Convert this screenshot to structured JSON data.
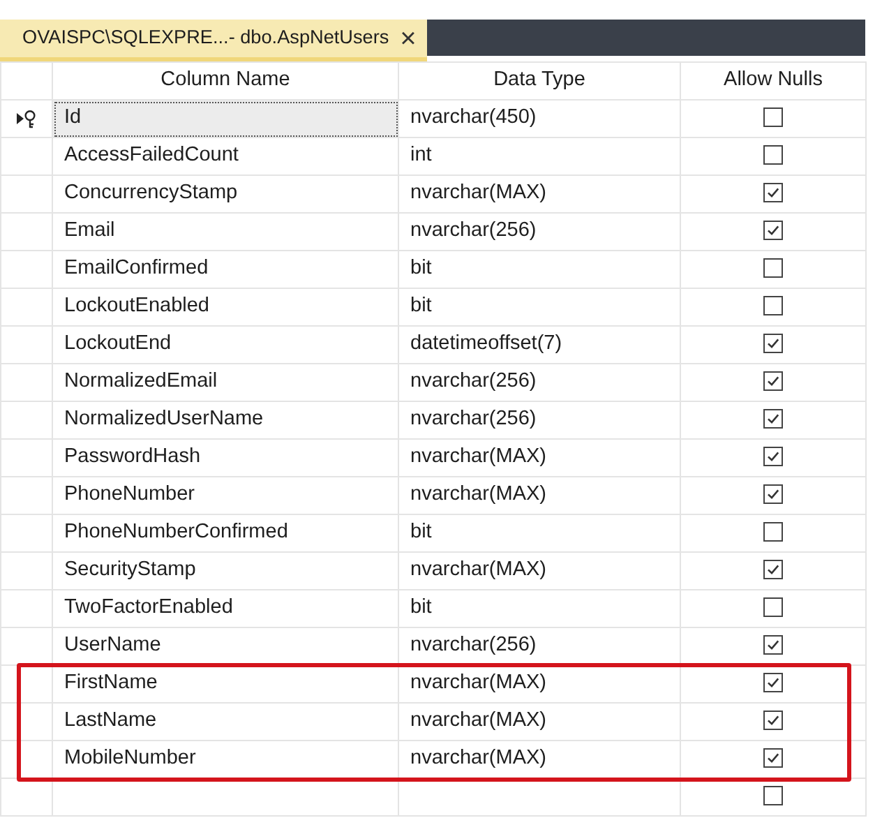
{
  "tab": {
    "title": "OVAISPC\\SQLEXPRE...- dbo.AspNetUsers",
    "close": "×"
  },
  "table": {
    "columns": [
      "Column Name",
      "Data Type",
      "Allow Nulls"
    ],
    "rows": [
      {
        "name": "Id",
        "type": "nvarchar(450)",
        "allow_nulls": false,
        "primary_key": true,
        "selected": true,
        "highlighted": false
      },
      {
        "name": "AccessFailedCount",
        "type": "int",
        "allow_nulls": false,
        "primary_key": false,
        "selected": false,
        "highlighted": false
      },
      {
        "name": "ConcurrencyStamp",
        "type": "nvarchar(MAX)",
        "allow_nulls": true,
        "primary_key": false,
        "selected": false,
        "highlighted": false
      },
      {
        "name": "Email",
        "type": "nvarchar(256)",
        "allow_nulls": true,
        "primary_key": false,
        "selected": false,
        "highlighted": false
      },
      {
        "name": "EmailConfirmed",
        "type": "bit",
        "allow_nulls": false,
        "primary_key": false,
        "selected": false,
        "highlighted": false
      },
      {
        "name": "LockoutEnabled",
        "type": "bit",
        "allow_nulls": false,
        "primary_key": false,
        "selected": false,
        "highlighted": false
      },
      {
        "name": "LockoutEnd",
        "type": "datetimeoffset(7)",
        "allow_nulls": true,
        "primary_key": false,
        "selected": false,
        "highlighted": false
      },
      {
        "name": "NormalizedEmail",
        "type": "nvarchar(256)",
        "allow_nulls": true,
        "primary_key": false,
        "selected": false,
        "highlighted": false
      },
      {
        "name": "NormalizedUserName",
        "type": "nvarchar(256)",
        "allow_nulls": true,
        "primary_key": false,
        "selected": false,
        "highlighted": false
      },
      {
        "name": "PasswordHash",
        "type": "nvarchar(MAX)",
        "allow_nulls": true,
        "primary_key": false,
        "selected": false,
        "highlighted": false
      },
      {
        "name": "PhoneNumber",
        "type": "nvarchar(MAX)",
        "allow_nulls": true,
        "primary_key": false,
        "selected": false,
        "highlighted": false
      },
      {
        "name": "PhoneNumberConfirmed",
        "type": "bit",
        "allow_nulls": false,
        "primary_key": false,
        "selected": false,
        "highlighted": false
      },
      {
        "name": "SecurityStamp",
        "type": "nvarchar(MAX)",
        "allow_nulls": true,
        "primary_key": false,
        "selected": false,
        "highlighted": false
      },
      {
        "name": "TwoFactorEnabled",
        "type": "bit",
        "allow_nulls": false,
        "primary_key": false,
        "selected": false,
        "highlighted": false
      },
      {
        "name": "UserName",
        "type": "nvarchar(256)",
        "allow_nulls": true,
        "primary_key": false,
        "selected": false,
        "highlighted": false
      },
      {
        "name": "FirstName",
        "type": "nvarchar(MAX)",
        "allow_nulls": true,
        "primary_key": false,
        "selected": false,
        "highlighted": true
      },
      {
        "name": "LastName",
        "type": "nvarchar(MAX)",
        "allow_nulls": true,
        "primary_key": false,
        "selected": false,
        "highlighted": true
      },
      {
        "name": "MobileNumber",
        "type": "nvarchar(MAX)",
        "allow_nulls": true,
        "primary_key": false,
        "selected": false,
        "highlighted": true
      }
    ],
    "new_row": {
      "allow_nulls": false
    }
  }
}
